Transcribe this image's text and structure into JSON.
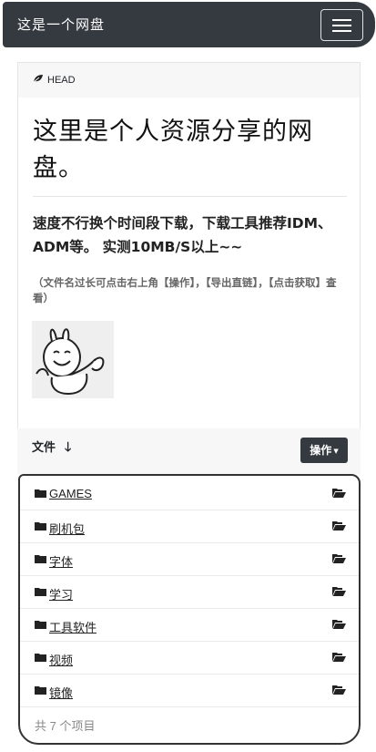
{
  "navbar": {
    "brand": "这是一个网盘"
  },
  "readme": {
    "head_label": "HEAD",
    "title": "这里是个人资源分享的网盘。",
    "intro": "速度不行换个时间段下载，下载工具推荐IDM、ADM等。 实测10MB/S以上~~",
    "note": "（文件名过长可点击右上角【操作】，【导出直链】，【点击获取】查看）"
  },
  "files": {
    "header": "文件",
    "operations_label": "操作",
    "items": [
      {
        "name": "GAMES"
      },
      {
        "name": "刷机包"
      },
      {
        "name": "字体"
      },
      {
        "name": "学习"
      },
      {
        "name": "工具软件"
      },
      {
        "name": "视频"
      },
      {
        "name": "镜像"
      }
    ],
    "count_text": "共 7 个项目"
  },
  "colors": {
    "dark": "#343a40",
    "header_bg": "#f7f7f7"
  },
  "icons": {
    "head": "leaf-icon",
    "sort": "arrow-down-icon",
    "folder": "folder-icon",
    "open": "folder-open-icon"
  }
}
